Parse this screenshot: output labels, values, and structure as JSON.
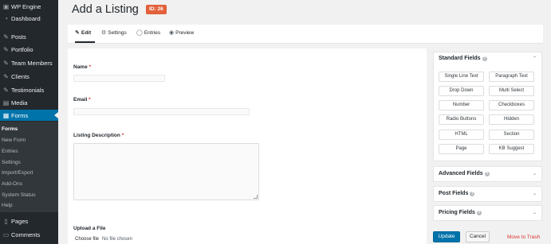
{
  "sidebar": {
    "items": [
      {
        "label": "WP Engine",
        "icon": "wp-engine-icon",
        "glyph": "▣"
      },
      {
        "label": "Dashboard",
        "icon": "dashboard-icon",
        "glyph": "◔"
      },
      {
        "label": "Posts",
        "icon": "pin-icon",
        "glyph": "✎"
      },
      {
        "label": "Portfolio",
        "icon": "pin-icon",
        "glyph": "✎"
      },
      {
        "label": "Team Members",
        "icon": "pin-icon",
        "glyph": "✎"
      },
      {
        "label": "Clients",
        "icon": "pin-icon",
        "glyph": "✎"
      },
      {
        "label": "Testimonials",
        "icon": "pin-icon",
        "glyph": "✎"
      },
      {
        "label": "Media",
        "icon": "media-icon",
        "glyph": "▤"
      },
      {
        "label": "Forms",
        "icon": "forms-icon",
        "glyph": "▦"
      }
    ],
    "submenu": [
      "Forms",
      "New Form",
      "Entries",
      "Settings",
      "Import/Export",
      "Add-Ons",
      "System Status",
      "Help"
    ],
    "bottom_items": [
      {
        "label": "Pages",
        "icon": "pages-icon",
        "glyph": "▯"
      },
      {
        "label": "Comments",
        "icon": "comments-icon",
        "glyph": "▭"
      }
    ]
  },
  "header": {
    "title": "Add a Listing",
    "chevron": "⌄",
    "badge": "ID: 26"
  },
  "tabs": [
    {
      "label": "Edit",
      "icon": "edit-icon",
      "glyph": "✎"
    },
    {
      "label": "Settings",
      "icon": "settings-icon",
      "glyph": "⚙"
    },
    {
      "label": "Entries",
      "icon": "entries-icon",
      "glyph": "◯"
    },
    {
      "label": "Preview",
      "icon": "preview-icon",
      "glyph": "◉"
    }
  ],
  "form": {
    "name_label": "Name",
    "email_label": "Email",
    "description_label": "Listing Description",
    "required_mark": "*",
    "upload_label": "Upload a File",
    "choose_file": "Choose file",
    "no_file": "No file chosen"
  },
  "panels": {
    "standard": {
      "title": "Standard Fields",
      "help": "?",
      "chevron": "⌃",
      "fields": [
        "Single Line Text",
        "Paragraph Text",
        "Drop Down",
        "Multi Select",
        "Number",
        "Checkboxes",
        "Radio Buttons",
        "Hidden",
        "HTML",
        "Section",
        "Page",
        "KB Suggest"
      ]
    },
    "advanced": {
      "title": "Advanced Fields",
      "help": "?",
      "chevron": "⌄"
    },
    "post": {
      "title": "Post Fields",
      "help": "?",
      "chevron": "⌄"
    },
    "pricing": {
      "title": "Pricing Fields",
      "help": "?",
      "chevron": "⌄"
    }
  },
  "actions": {
    "update": "Update",
    "cancel": "Cancel",
    "trash": "Move to Trash"
  },
  "colors": {
    "sidebar_bg": "#23282d",
    "active_blue": "#0073aa",
    "badge_orange": "#e2603a",
    "trash_red": "#dc3232"
  }
}
